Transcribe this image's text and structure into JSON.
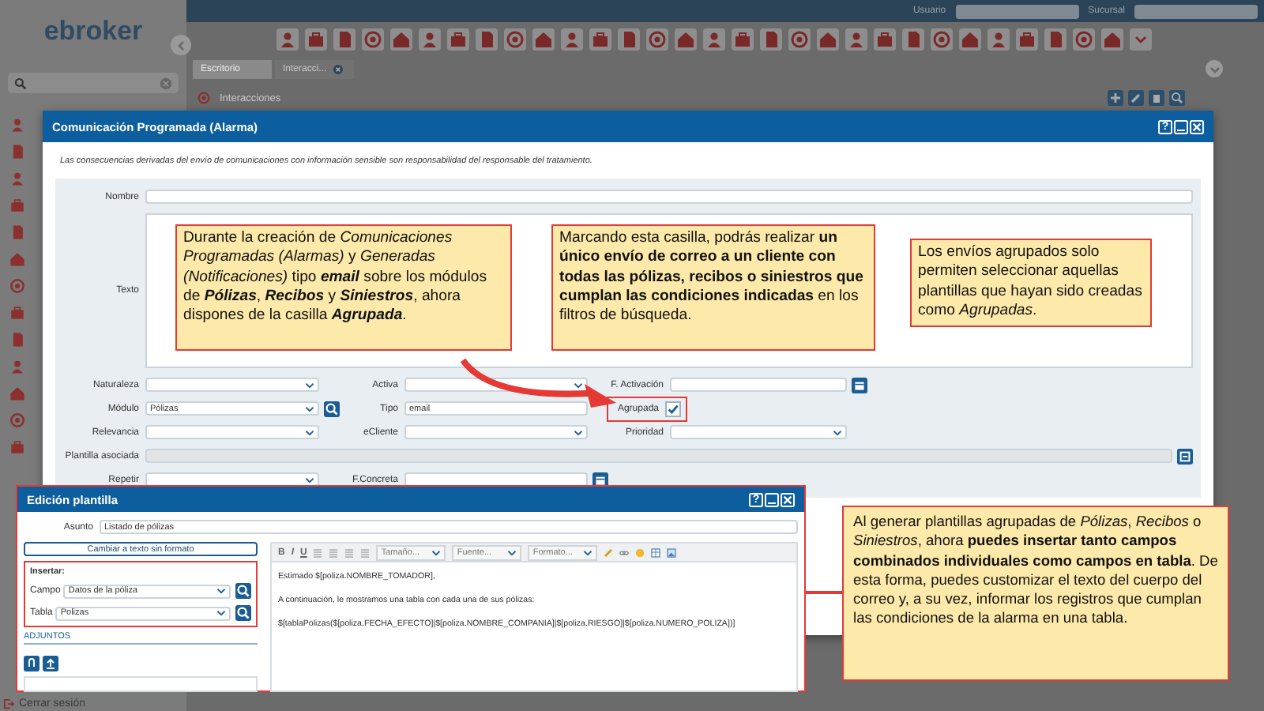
{
  "sidebar": {
    "logo": "ebroker",
    "footer": "Cerrar sesión"
  },
  "header": {
    "user_label": "Usuario",
    "branch_label": "Sucursal"
  },
  "tabs": [
    {
      "label": "Escritorio",
      "selected": true,
      "closable": false
    },
    {
      "label": "Interacci...",
      "selected": false,
      "closable": true
    }
  ],
  "page_title": "Interacciones",
  "alarm_dialog": {
    "title": "Comunicación Programada (Alarma)",
    "help_button": "?",
    "notice": "Las consecuencias derivadas del envío de comunicaciones con información sensible son responsabilidad del responsable del tratamiento.",
    "name_label": "Nombre",
    "text_label": "Texto",
    "rows": [
      [
        {
          "kind": "select",
          "label": "Naturaleza"
        },
        {
          "kind": "select",
          "label": "Activa"
        },
        {
          "kind": "date",
          "label": "F. Activación"
        }
      ],
      [
        {
          "kind": "lookup",
          "label": "Módulo",
          "value": "Pólizas"
        },
        {
          "kind": "text",
          "label": "Tipo",
          "value": "email"
        },
        {
          "kind": "checkbox",
          "label": "Agrupada",
          "checked": true,
          "highlighted": true
        }
      ],
      [
        {
          "kind": "select",
          "label": "Relevancia"
        },
        {
          "kind": "select",
          "label": "eCliente"
        },
        {
          "kind": "select",
          "label": "Prioridad"
        }
      ],
      [
        {
          "kind": "wide",
          "label": "Plantilla asociada",
          "disabled": true
        }
      ],
      [
        {
          "kind": "select",
          "label": "Repetir"
        },
        {
          "kind": "date",
          "label": "F.Concreta"
        }
      ]
    ]
  },
  "callouts": [
    "Durante la creación de *Comunicaciones Programadas (Alarmas)* y *Generadas (Notificaciones)* tipo **email** sobre los módulos de **Pólizas**, **Recibos** y **Siniestros**, ahora dispones de la casilla **Agrupada**.",
    "Marcando esta casilla, podrás realizar **un único envío de correo a un cliente con todas las pólizas, recibos o siniestros que cumplan las condiciones indicadas** en los filtros de búsqueda.",
    "Los envíos agrupados solo permiten seleccionar aquellas plantillas que hayan sido creadas como *Agrupadas*.",
    "Al generar plantillas agrupadas de *Pólizas*, *Recibos* o *Siniestros*, ahora **puedes insertar tanto campos combinados individuales como campos en tabla**. De esta forma, puedes customizar el texto del cuerpo del correo y, a su vez, informar los registros que cumplan las condiciones de la alarma en una tabla."
  ],
  "template_dialog": {
    "title": "Edición plantilla",
    "help_button": "?",
    "subject_label": "Asunto",
    "subject": "Listado de pólizas",
    "plain_text_button": "Cambiar a texto sin formato",
    "insert_title": "Insertar:",
    "insert_fields": [
      {
        "label": "Campo",
        "value": "Datos de la póliza"
      },
      {
        "label": "Tabla",
        "value": "Polizas"
      }
    ],
    "attachments_title": "ADJUNTOS",
    "format_buttons": [
      "B",
      "I",
      "U"
    ],
    "dropdowns": [
      "Tamaño...",
      "Fuente...",
      "Formato..."
    ],
    "body": [
      "Estimado $[poliza.NOMBRE_TOMADOR],",
      "A continuación, le mostramos una tabla con cada una de sus pólizas:",
      "$[tablaPolizas($[poliza.FECHA_EFECTO]|$[poliza.NOMBRE_COMPANIA]|$[poliza.RIESGO]|$[poliza.NUMERO_POLIZA])]"
    ]
  }
}
